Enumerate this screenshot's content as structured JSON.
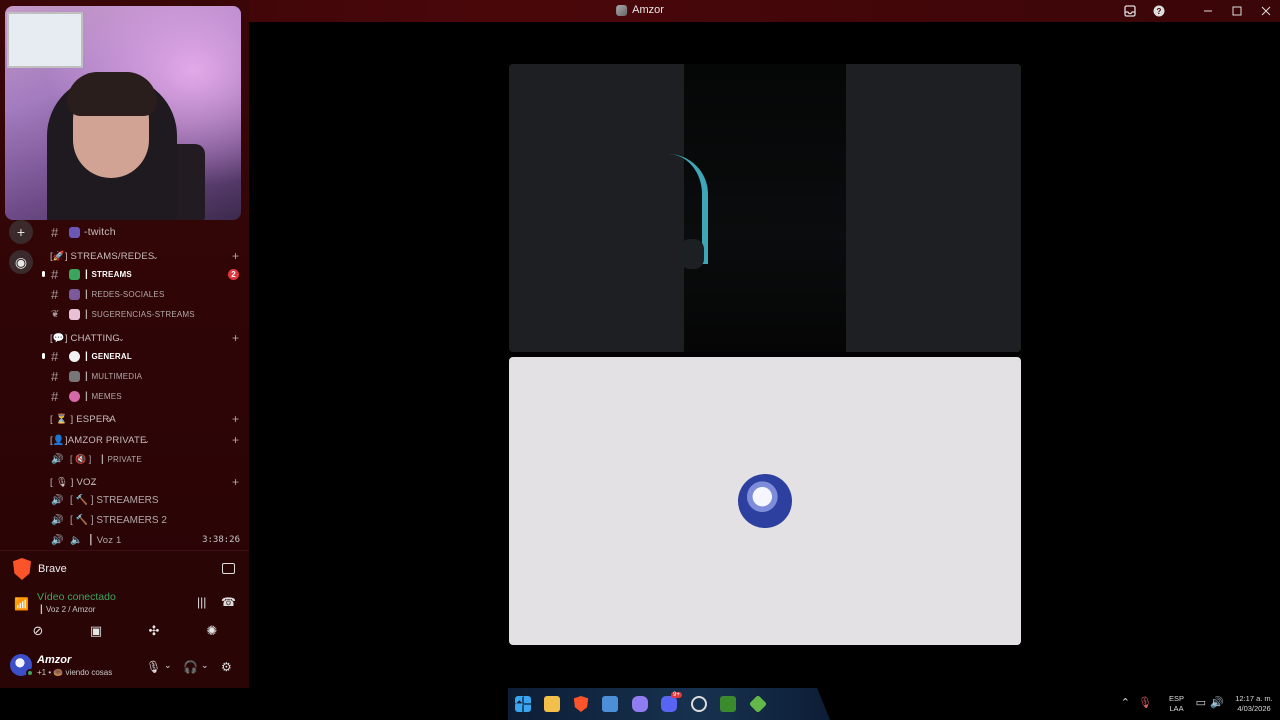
{
  "window": {
    "title": "Amzor"
  },
  "channels": {
    "twitch_label": "-twitch",
    "streams_category": "[🚀] STREAMS/REDES",
    "streams": "┃ STREAMS",
    "streams_badge": "2",
    "redes": "┃ REDES-SOCIALES",
    "sugerencias": "┃ SUGERENCIAS-STREAMS",
    "chatting_category": "[💬] CHATTING",
    "general": "┃ GENERAL",
    "multimedia": "┃ MULTIMEDIA",
    "memes": "┃ MEMES",
    "espera_category": "[ ⏳ ] ESPERA",
    "private_category": "[👤]AMZOR PRIVATE",
    "private": "┃ PRIVATE",
    "private_prefix": "[ 🔇 ]",
    "voz_category": "[ 🎙 ] VOZ",
    "streamers": "[ 🔨 ] STREAMERS",
    "streamers2": "[ 🔨 ] STREAMERS 2",
    "voz1": "┃ Voz 1",
    "voz1_timer": "3:38:26"
  },
  "panel": {
    "app_name": "Brave",
    "connection_title": "Vídeo conectado",
    "connection_sub": "┃ Voz 2 / Amzor",
    "username": "Amzor",
    "user_status": "+1 • 🍩 viendo cosas"
  },
  "taskbar": {
    "lang_top": "ESP",
    "lang_bottom": "LAA",
    "time": "12:17 a. m.",
    "date": "4/03/2026",
    "discord_badge": "9+"
  },
  "colors": {
    "sidebar": "#3b0608",
    "titlebar": "#4a070a",
    "connected_green": "#3ba55d",
    "badge_red": "#e0383e",
    "stage_tile": "#1e1f22",
    "light_tile": "#e3e1e3"
  }
}
